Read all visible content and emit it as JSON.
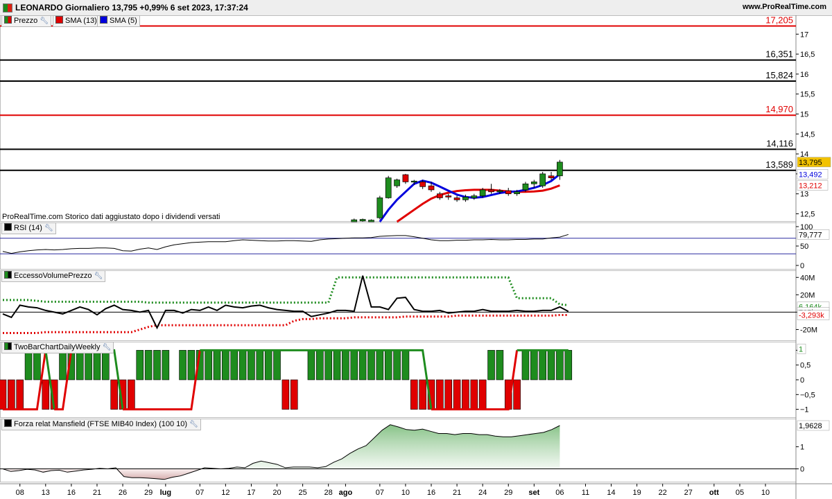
{
  "header": {
    "title": "LEONARDO Giornaliero 13,795 +0,99% 6 set 2023, 17:37:24",
    "site": "www.ProRealTime.com"
  },
  "colors": {
    "up": "#1e8c1e",
    "down": "#e00000",
    "sma13": "#e00000",
    "sma5": "#0000dd",
    "last_bg": "#f2c200",
    "grid": "#dddddd"
  },
  "chart_data": [
    {
      "type": "candlestick",
      "panel": "price",
      "legend": [
        "Prezzo",
        "SMA (13)",
        "SMA (5)"
      ],
      "note": "ProRealTime.com Storico dati aggiustato dopo i dividendi versati",
      "ylim": [
        12.3,
        17.3
      ],
      "y_ticks": [
        {
          "v": 12.5,
          "t": "12,5"
        },
        {
          "v": 13,
          "t": "13"
        },
        {
          "v": 13.5,
          "t": "13,5"
        },
        {
          "v": 14,
          "t": "14"
        },
        {
          "v": 14.5,
          "t": "14,5"
        },
        {
          "v": 15,
          "t": "15"
        },
        {
          "v": 15.5,
          "t": "15,5"
        },
        {
          "v": 16,
          "t": "16"
        },
        {
          "v": 16.5,
          "t": "16,5"
        },
        {
          "v": 17,
          "t": "17"
        }
      ],
      "levels": [
        {
          "value": 17.205,
          "label": "17,205",
          "color": "#e00000"
        },
        {
          "value": 16.351,
          "label": "16,351",
          "color": "#000000"
        },
        {
          "value": 15.824,
          "label": "15,824",
          "color": "#000000"
        },
        {
          "value": 14.97,
          "label": "14,970",
          "color": "#e00000"
        },
        {
          "value": 14.116,
          "label": "14,116",
          "color": "#000000"
        },
        {
          "value": 13.589,
          "label": "13,589",
          "color": "#000000"
        }
      ],
      "last_value": {
        "value": 13.795,
        "label": "13,795"
      },
      "sma_values": [
        {
          "name": "SMA (5)",
          "value": 13.492,
          "label": "13,492",
          "color": "#0000dd"
        },
        {
          "name": "SMA (13)",
          "value": 13.212,
          "label": "13,212",
          "color": "#e00000"
        }
      ],
      "candles": [
        {
          "i": 41,
          "o": 12.3,
          "h": 12.38,
          "l": 12.3,
          "c": 12.35
        },
        {
          "i": 42,
          "o": 12.32,
          "h": 12.38,
          "l": 12.3,
          "c": 12.36
        },
        {
          "i": 43,
          "o": 12.3,
          "h": 12.36,
          "l": 12.3,
          "c": 12.34
        },
        {
          "i": 44,
          "o": 12.4,
          "h": 12.95,
          "l": 12.36,
          "c": 12.9
        },
        {
          "i": 45,
          "o": 12.9,
          "h": 13.45,
          "l": 12.88,
          "c": 13.4
        },
        {
          "i": 46,
          "o": 13.2,
          "h": 13.38,
          "l": 13.15,
          "c": 13.35
        },
        {
          "i": 47,
          "o": 13.48,
          "h": 13.5,
          "l": 13.25,
          "c": 13.3
        },
        {
          "i": 48,
          "o": 13.3,
          "h": 13.35,
          "l": 13.22,
          "c": 13.32
        },
        {
          "i": 49,
          "o": 13.3,
          "h": 13.35,
          "l": 13.12,
          "c": 13.18
        },
        {
          "i": 50,
          "o": 13.2,
          "h": 13.3,
          "l": 13.05,
          "c": 13.1
        },
        {
          "i": 51,
          "o": 13.0,
          "h": 13.05,
          "l": 12.85,
          "c": 12.9
        },
        {
          "i": 52,
          "o": 12.95,
          "h": 13.0,
          "l": 12.85,
          "c": 12.92
        },
        {
          "i": 53,
          "o": 12.9,
          "h": 12.95,
          "l": 12.8,
          "c": 12.85
        },
        {
          "i": 54,
          "o": 12.85,
          "h": 12.98,
          "l": 12.8,
          "c": 12.92
        },
        {
          "i": 55,
          "o": 12.9,
          "h": 13.0,
          "l": 12.85,
          "c": 12.95
        },
        {
          "i": 56,
          "o": 12.95,
          "h": 13.15,
          "l": 12.9,
          "c": 13.1
        },
        {
          "i": 57,
          "o": 13.1,
          "h": 13.25,
          "l": 13.0,
          "c": 13.05
        },
        {
          "i": 58,
          "o": 13.05,
          "h": 13.12,
          "l": 13.0,
          "c": 13.08
        },
        {
          "i": 59,
          "o": 13.08,
          "h": 13.15,
          "l": 12.95,
          "c": 13.0
        },
        {
          "i": 60,
          "o": 13.0,
          "h": 13.1,
          "l": 12.95,
          "c": 13.05
        },
        {
          "i": 61,
          "o": 13.1,
          "h": 13.3,
          "l": 13.05,
          "c": 13.25
        },
        {
          "i": 62,
          "o": 13.25,
          "h": 13.35,
          "l": 13.15,
          "c": 13.3
        },
        {
          "i": 63,
          "o": 13.2,
          "h": 13.55,
          "l": 13.15,
          "c": 13.5
        },
        {
          "i": 64,
          "o": 13.45,
          "h": 13.55,
          "l": 13.35,
          "c": 13.4
        },
        {
          "i": 65,
          "o": 13.45,
          "h": 13.85,
          "l": 13.35,
          "c": 13.795
        }
      ],
      "sma5": [
        {
          "i": 44,
          "v": 12.3
        },
        {
          "i": 45,
          "v": 12.6
        },
        {
          "i": 46,
          "v": 12.85
        },
        {
          "i": 47,
          "v": 13.05
        },
        {
          "i": 48,
          "v": 13.25
        },
        {
          "i": 49,
          "v": 13.33
        },
        {
          "i": 50,
          "v": 13.28
        },
        {
          "i": 51,
          "v": 13.18
        },
        {
          "i": 52,
          "v": 13.08
        },
        {
          "i": 53,
          "v": 12.98
        },
        {
          "i": 54,
          "v": 12.92
        },
        {
          "i": 55,
          "v": 12.9
        },
        {
          "i": 56,
          "v": 12.92
        },
        {
          "i": 57,
          "v": 12.97
        },
        {
          "i": 58,
          "v": 13.02
        },
        {
          "i": 59,
          "v": 13.05
        },
        {
          "i": 60,
          "v": 13.06
        },
        {
          "i": 61,
          "v": 13.1
        },
        {
          "i": 62,
          "v": 13.15
        },
        {
          "i": 63,
          "v": 13.22
        },
        {
          "i": 64,
          "v": 13.32
        },
        {
          "i": 65,
          "v": 13.492
        }
      ],
      "sma13": [
        {
          "i": 46,
          "v": 12.3
        },
        {
          "i": 47,
          "v": 12.45
        },
        {
          "i": 48,
          "v": 12.6
        },
        {
          "i": 49,
          "v": 12.75
        },
        {
          "i": 50,
          "v": 12.88
        },
        {
          "i": 51,
          "v": 12.97
        },
        {
          "i": 52,
          "v": 13.03
        },
        {
          "i": 53,
          "v": 13.07
        },
        {
          "i": 54,
          "v": 13.09
        },
        {
          "i": 55,
          "v": 13.1
        },
        {
          "i": 56,
          "v": 13.1
        },
        {
          "i": 57,
          "v": 13.1
        },
        {
          "i": 58,
          "v": 13.08
        },
        {
          "i": 59,
          "v": 13.06
        },
        {
          "i": 60,
          "v": 13.05
        },
        {
          "i": 61,
          "v": 13.05
        },
        {
          "i": 62,
          "v": 13.06
        },
        {
          "i": 63,
          "v": 13.08
        },
        {
          "i": 64,
          "v": 13.13
        },
        {
          "i": 65,
          "v": 13.212
        }
      ]
    },
    {
      "type": "line",
      "panel": "rsi",
      "legend": "RSI (14)",
      "ylim": [
        0,
        100
      ],
      "y_ticks": [
        {
          "v": 100,
          "t": "100"
        },
        {
          "v": 50,
          "t": "50"
        },
        {
          "v": 0,
          "t": "0"
        }
      ],
      "bands": [
        70,
        30
      ],
      "last_value": {
        "value": 79.777,
        "label": "79,777"
      },
      "values": [
        36,
        31,
        35,
        38,
        40,
        41,
        40,
        41,
        43,
        44,
        44,
        45,
        45,
        44,
        38,
        37,
        42,
        45,
        41,
        48,
        53,
        56,
        59,
        60,
        61,
        61,
        61,
        64,
        66,
        65,
        64,
        63,
        63,
        64,
        64,
        63,
        62,
        66,
        68,
        69,
        70,
        71,
        71,
        72,
        75,
        76,
        77,
        77,
        74,
        70,
        66,
        64,
        64,
        65,
        65,
        66,
        66,
        67,
        66,
        66,
        67,
        67,
        68,
        68,
        71,
        73,
        79.777
      ]
    },
    {
      "type": "line",
      "panel": "volume_excess",
      "legend": "EccessoVolumePrezzo",
      "ylim": [
        -30,
        45
      ],
      "y_ticks": [
        {
          "v": 40,
          "t": "40M"
        },
        {
          "v": 20,
          "t": "20M"
        },
        {
          "v": 0,
          "t": "0"
        },
        {
          "v": -20,
          "t": "-20M"
        }
      ],
      "last_values": [
        {
          "value": 6.164,
          "label": "6,164k",
          "color": "#1e8c1e"
        },
        {
          "value": 0.765,
          "label": "765k",
          "color": "#000000"
        },
        {
          "value": -3.293,
          "label": "-3,293k",
          "color": "#e00000"
        }
      ],
      "upper": [
        14,
        14,
        14,
        14,
        13,
        12,
        12,
        12,
        12,
        12,
        12,
        12,
        12,
        12,
        12,
        12,
        12,
        11,
        11,
        11,
        11,
        11,
        11,
        11,
        11,
        11,
        11,
        11,
        11,
        11,
        11,
        11,
        11,
        11,
        11,
        11,
        11,
        11,
        11,
        40,
        40,
        40,
        40,
        40,
        40,
        40,
        40,
        40,
        40,
        40,
        40,
        40,
        40,
        40,
        40,
        40,
        40,
        40,
        40,
        40,
        16,
        16,
        16,
        16,
        16,
        9,
        8
      ],
      "lower": [
        -24,
        -24,
        -24,
        -24,
        -24,
        -23,
        -23,
        -23,
        -23,
        -23,
        -23,
        -23,
        -23,
        -23,
        -23,
        -23,
        -20,
        -17,
        -15,
        -15,
        -15,
        -15,
        -15,
        -15,
        -15,
        -15,
        -15,
        -15,
        -15,
        -15,
        -15,
        -15,
        -15,
        -15,
        -10,
        -8,
        -8,
        -7,
        -7,
        -7,
        -7,
        -6,
        -6,
        -6,
        -6,
        -6,
        -6,
        -5,
        -5,
        -5,
        -5,
        -5,
        -5,
        -4,
        -4,
        -4,
        -4,
        -4,
        -4,
        -4,
        -4,
        -4,
        -4,
        -4,
        -4,
        -3.3,
        -3.3
      ],
      "values": [
        -2,
        -6,
        8,
        6,
        5,
        2,
        0,
        -2,
        2,
        6,
        3,
        -3,
        4,
        8,
        3,
        2,
        0,
        2,
        -18,
        2,
        2,
        -1,
        3,
        2,
        6,
        2,
        8,
        6,
        5,
        7,
        8,
        5,
        3,
        2,
        1,
        1,
        -5,
        -3,
        -1,
        2,
        2,
        1,
        42,
        6,
        6,
        3,
        16,
        17,
        3,
        1,
        1,
        2,
        -1,
        0,
        1,
        1,
        3,
        1,
        1,
        1,
        2,
        1,
        1,
        2,
        2,
        6,
        0.765
      ]
    },
    {
      "type": "bar",
      "panel": "twobar",
      "legend": "TwoBarChartDailyWeekly",
      "ylim": [
        -1.15,
        1.15
      ],
      "y_ticks": [
        {
          "v": 1,
          "t": "1"
        },
        {
          "v": 0.5,
          "t": "0,5"
        },
        {
          "v": 0,
          "t": "0"
        },
        {
          "v": -0.5,
          "t": "−0,5"
        },
        {
          "v": -1,
          "t": "−1"
        }
      ],
      "last_value": {
        "value": 1,
        "label": "1"
      },
      "daily": [
        -1,
        -1,
        -1,
        1,
        1,
        -1,
        -1,
        1,
        1,
        1,
        1,
        1,
        1,
        -1,
        -1,
        -1,
        1,
        1,
        1,
        1,
        0,
        1,
        1,
        1,
        1,
        1,
        1,
        1,
        1,
        1,
        1,
        1,
        1,
        -1,
        -1,
        0,
        1,
        1,
        1,
        1,
        1,
        1,
        1,
        1,
        1,
        1,
        1,
        1,
        -1,
        -1,
        -1,
        -1,
        -1,
        -1,
        -1,
        -1,
        -1,
        1,
        1,
        -1,
        -1,
        1,
        1,
        1,
        1,
        1,
        1
      ],
      "weekly": [
        -1,
        -1,
        -1,
        -1,
        -1,
        1,
        -1,
        -1,
        1,
        1,
        1,
        1,
        1,
        1,
        -1,
        -1,
        -1,
        -1,
        -1,
        -1,
        -1,
        -1,
        -1,
        1,
        1,
        1,
        1,
        1,
        1,
        1,
        1,
        1,
        1,
        1,
        1,
        1,
        1,
        1,
        1,
        1,
        1,
        1,
        1,
        1,
        1,
        1,
        1,
        1,
        1,
        1,
        -1,
        -1,
        -1,
        -1,
        -1,
        -1,
        -1,
        -1,
        -1,
        -1,
        1,
        1,
        1,
        1,
        1,
        1,
        1
      ]
    },
    {
      "type": "area",
      "panel": "mansfield",
      "legend": "Forza relat Mansfield (FTSE MIB40 Index) (100 10)",
      "ylim": [
        -0.55,
        2.15
      ],
      "y_ticks": [
        {
          "v": 1,
          "t": "1"
        },
        {
          "v": 0,
          "t": "0"
        }
      ],
      "last_value": {
        "value": 1.9628,
        "label": "1,9628"
      },
      "values": [
        0.0,
        -0.12,
        -0.08,
        -0.02,
        -0.05,
        -0.15,
        -0.08,
        -0.06,
        -0.15,
        -0.1,
        -0.05,
        -0.02,
        0.02,
        0.0,
        0.05,
        -0.35,
        -0.4,
        -0.4,
        -0.42,
        -0.45,
        -0.48,
        -0.38,
        -0.32,
        -0.2,
        -0.08,
        0.05,
        0.02,
        0.0,
        0.02,
        0.08,
        0.05,
        0.25,
        0.35,
        0.28,
        0.2,
        0.05,
        0.08,
        0.08,
        0.08,
        0.05,
        0.1,
        0.3,
        0.45,
        0.7,
        0.9,
        1.05,
        1.4,
        1.75,
        2.0,
        1.9,
        1.78,
        1.75,
        1.8,
        1.7,
        1.6,
        1.6,
        1.55,
        1.6,
        1.6,
        1.55,
        1.55,
        1.48,
        1.45,
        1.45,
        1.5,
        1.55,
        1.6,
        1.65,
        1.78,
        1.9628
      ]
    },
    {
      "type": "axis",
      "panel": "time",
      "x_ticks": [
        {
          "i": 2,
          "t": "08",
          "bold": false
        },
        {
          "i": 5,
          "t": "13",
          "bold": false
        },
        {
          "i": 8,
          "t": "16",
          "bold": false
        },
        {
          "i": 11,
          "t": "21",
          "bold": false
        },
        {
          "i": 14,
          "t": "26",
          "bold": false
        },
        {
          "i": 17,
          "t": "29",
          "bold": false
        },
        {
          "i": 19,
          "t": "lug",
          "bold": true
        },
        {
          "i": 23,
          "t": "07",
          "bold": false
        },
        {
          "i": 26,
          "t": "12",
          "bold": false
        },
        {
          "i": 29,
          "t": "17",
          "bold": false
        },
        {
          "i": 32,
          "t": "20",
          "bold": false
        },
        {
          "i": 35,
          "t": "25",
          "bold": false
        },
        {
          "i": 38,
          "t": "28",
          "bold": false
        },
        {
          "i": 40,
          "t": "ago",
          "bold": true
        },
        {
          "i": 44,
          "t": "07",
          "bold": false
        },
        {
          "i": 47,
          "t": "10",
          "bold": false
        },
        {
          "i": 50,
          "t": "16",
          "bold": false
        },
        {
          "i": 53,
          "t": "21",
          "bold": false
        },
        {
          "i": 56,
          "t": "24",
          "bold": false
        },
        {
          "i": 59,
          "t": "29",
          "bold": false
        },
        {
          "i": 62,
          "t": "set",
          "bold": true
        },
        {
          "i": 65,
          "t": "06",
          "bold": false
        },
        {
          "i": 68,
          "t": "11",
          "bold": false
        },
        {
          "i": 71,
          "t": "14",
          "bold": false
        },
        {
          "i": 74,
          "t": "19",
          "bold": false
        },
        {
          "i": 77,
          "t": "22",
          "bold": false
        },
        {
          "i": 80,
          "t": "27",
          "bold": false
        },
        {
          "i": 83,
          "t": "ott",
          "bold": true
        },
        {
          "i": 86,
          "t": "05",
          "bold": false
        },
        {
          "i": 89,
          "t": "10",
          "bold": false
        }
      ]
    }
  ]
}
